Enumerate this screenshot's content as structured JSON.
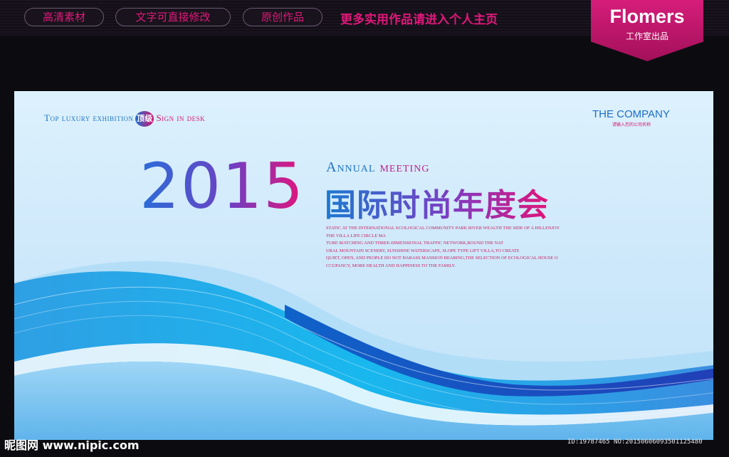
{
  "topbar": {
    "pills": [
      "高清素材",
      "文字可直接修改",
      "原创作品"
    ],
    "promo": "更多实用作品请进入个人主页"
  },
  "brand": {
    "name": "Flomers",
    "sub": "工作室出品",
    "color": "#d61d7a"
  },
  "banner": {
    "tagline_part1": "Top luxury exhibition",
    "badge": "顶级",
    "tagline_part2": "Sign in desk",
    "company": "THE COMPANY",
    "company_sub": "请输入您的公司名称",
    "year": "2015",
    "annual": "Annual",
    "meeting": "meeting",
    "cn_title": "国际时尚年度会",
    "paragraph": [
      "STATIC AT THE INTERNATIONAL ECOLOGICAL COMMUNITY PARK RIVER WEALTH THE SIDE OF A HILLENJOY",
      "THE VILLA LIFE CIRCLE MA",
      "TURE MATCHING AND THREE-DIMENSIONAL TRAFFIC NETWORK,ROUND THE NAT",
      "URAL MOUNTAIN SCENERY, SUNSHINE WATERSCAPE, SLOPE TYPE LIFT VILLA,TO CREATE",
      "QUIET, OPEN, AND PEOPLE DO NOT HARASS MANSION BEARING,THE SELECTION OF ECOLOGICAL HOUSE O",
      "CCUPANCY, MORE HEALTH AND HAPPINESS TO THE FAMILY."
    ],
    "colors": {
      "blue": "#1f74c4",
      "magenta": "#d4166f"
    }
  },
  "watermark": {
    "left": "昵图网 www.nipic.com",
    "right": "ID:19787465 NO:20150606093501125480"
  }
}
